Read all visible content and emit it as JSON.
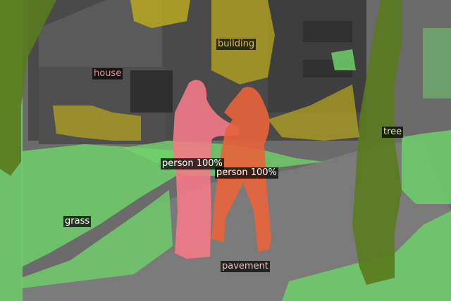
{
  "labels": {
    "building": "building",
    "house": "house",
    "tree": "tree",
    "person_left": "person 100%",
    "person_right": "person 100%",
    "grass": "grass",
    "pavement": "pavement"
  },
  "colors": {
    "building": "#dcc84a",
    "house": "#f08a8a",
    "tree": "#d8e8b0",
    "person": "#ffffff",
    "grass": "#ffffff",
    "pavement": "#f2c0b8",
    "mask_grass": "#6fcf6a",
    "mask_tree": "#5a7a1e",
    "mask_building": "#b9a81e",
    "mask_person_left": "#f27a86",
    "mask_person_right": "#e8633a"
  }
}
